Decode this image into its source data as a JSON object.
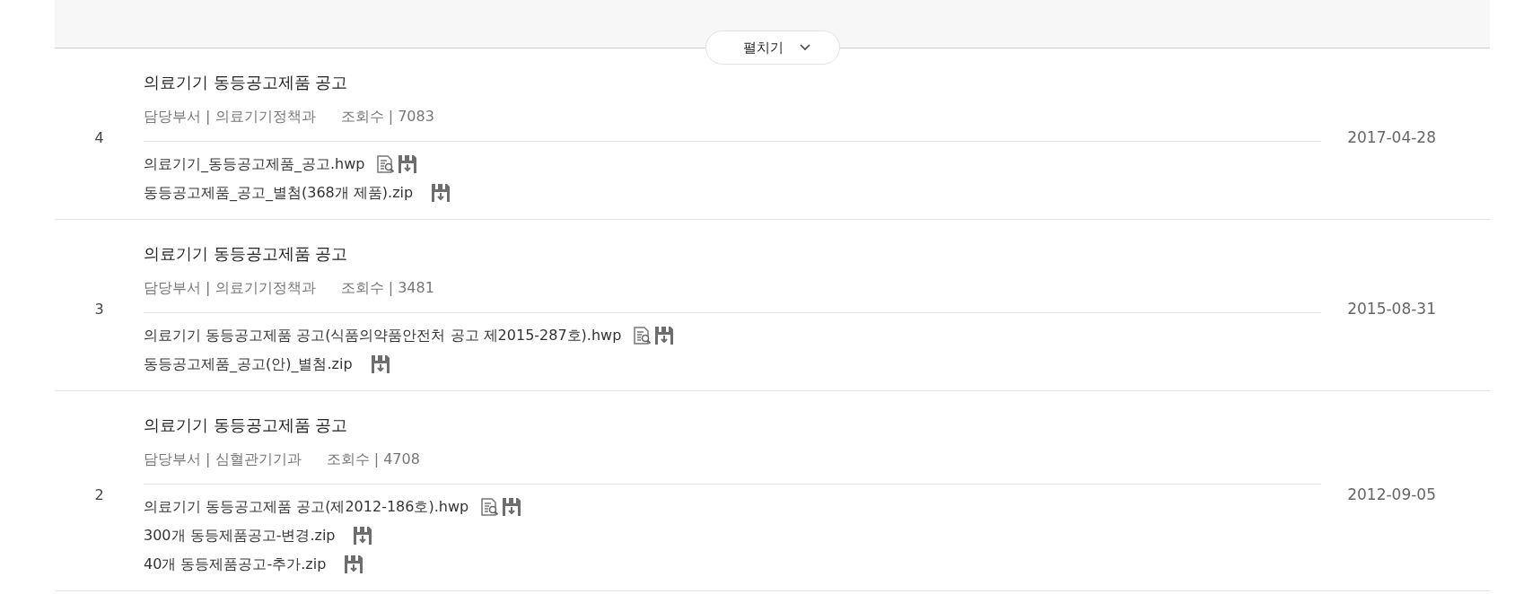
{
  "expand_button": {
    "label": "펼치기"
  },
  "posts": [
    {
      "number": "4",
      "title": "의료기기 동등공고제품 공고",
      "department": "담당부서 | 의료기기정책과",
      "views": "조회수 | 7083",
      "date": "2017-04-28",
      "files": [
        {
          "name": "의료기기_동등공고제품_공고.hwp",
          "preview": true
        },
        {
          "name": "동등공고제품_공고_별첨(368개 제품).zip",
          "preview": false
        }
      ]
    },
    {
      "number": "3",
      "title": "의료기기 동등공고제품 공고",
      "department": "담당부서 | 의료기기정책과",
      "views": "조회수 | 3481",
      "date": "2015-08-31",
      "files": [
        {
          "name": "의료기기 동등공고제품 공고(식품의약품안전처 공고 제2015-287호).hwp",
          "preview": true
        },
        {
          "name": "동등공고제품_공고(안)_별첨.zip",
          "preview": false
        }
      ]
    },
    {
      "number": "2",
      "title": "의료기기 동등공고제품 공고",
      "department": "담당부서 | 심혈관기기과",
      "views": "조회수 | 4708",
      "date": "2012-09-05",
      "files": [
        {
          "name": "의료기기 동등공고제품 공고(제2012-186호).hwp",
          "preview": true
        },
        {
          "name": "300개 동등제품공고-변경.zip",
          "preview": false
        },
        {
          "name": "40개 동등제품공고-추가.zip",
          "preview": false
        }
      ]
    }
  ]
}
